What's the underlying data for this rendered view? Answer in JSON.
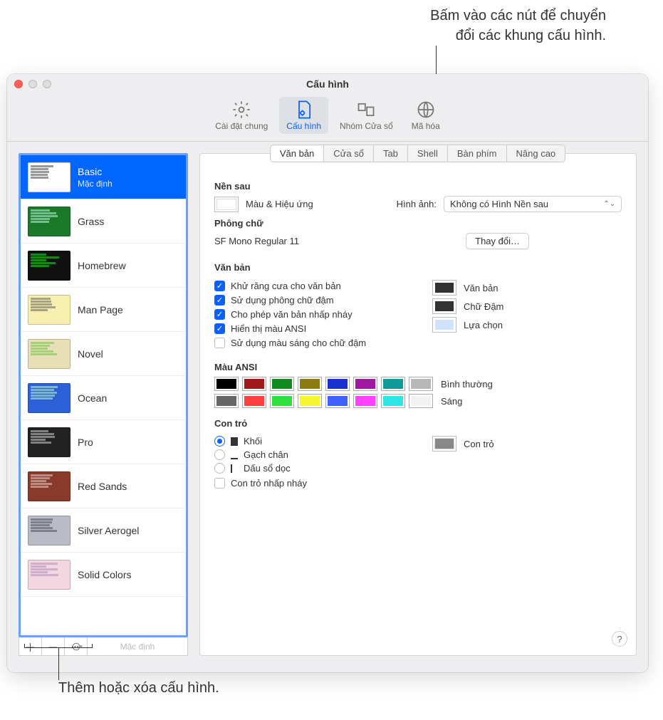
{
  "callouts": {
    "top": "Bấm vào các nút để chuyển\nđổi các khung cấu hình.",
    "bottom": "Thêm hoặc xóa cấu hình."
  },
  "window": {
    "title": "Cấu hình"
  },
  "toolbar": {
    "general": "Cài đặt chung",
    "profiles": "Cấu hình",
    "windowGroups": "Nhóm Cửa sổ",
    "encodings": "Mã hóa"
  },
  "profiles": [
    {
      "name": "Basic",
      "subtitle": "Mặc định",
      "bg": "#ffffff",
      "fg": "#333"
    },
    {
      "name": "Grass",
      "bg": "#1b7a2a",
      "fg": "#cfe"
    },
    {
      "name": "Homebrew",
      "bg": "#111",
      "fg": "#2f2"
    },
    {
      "name": "Man Page",
      "bg": "#f7efb0",
      "fg": "#555"
    },
    {
      "name": "Novel",
      "bg": "#e8dfb6",
      "fg": "#6b4"
    },
    {
      "name": "Ocean",
      "bg": "#2c5fd8",
      "fg": "#cfe"
    },
    {
      "name": "Pro",
      "bg": "#222",
      "fg": "#ddd"
    },
    {
      "name": "Red Sands",
      "bg": "#8a3a2a",
      "fg": "#edd"
    },
    {
      "name": "Silver Aerogel",
      "bg": "#b9bcc5",
      "fg": "#445"
    },
    {
      "name": "Solid Colors",
      "bg": "#f4d6e0",
      "fg": "#a8b"
    }
  ],
  "sidebarFooter": {
    "default": "Mặc định"
  },
  "panelTabs": [
    "Văn bản",
    "Cửa sổ",
    "Tab",
    "Shell",
    "Bàn phím",
    "Nâng cao"
  ],
  "sections": {
    "background": "Nền sau",
    "colorEffects": "Màu & Hiệu ứng",
    "imageLabel": "Hình ảnh:",
    "imageValue": "Không có Hình Nền sau",
    "font": "Phông chữ",
    "fontValue": "SF Mono Regular 11",
    "change": "Thay đổi…",
    "text": "Văn bản",
    "checks": {
      "antialias": "Khử răng cưa cho văn bản",
      "bold": "Sử dụng phông chữ đậm",
      "blink": "Cho phép văn bản nhấp nháy",
      "ansi": "Hiển thị màu ANSI",
      "bright": "Sử dụng màu sáng cho chữ đậm"
    },
    "wells": {
      "text": "Văn bản",
      "bold": "Chữ Đậm",
      "selection": "Lựa chọn"
    },
    "ansiTitle": "Màu ANSI",
    "ansiNormal": "Bình thường",
    "ansiBright": "Sáng",
    "ansiColors": {
      "normal": [
        "#000000",
        "#a01818",
        "#118a20",
        "#8a7a10",
        "#1a2fd0",
        "#a018a0",
        "#109a9a",
        "#b8b8b8"
      ],
      "bright": [
        "#666666",
        "#ff4040",
        "#30e040",
        "#f5f530",
        "#4060ff",
        "#ff40ff",
        "#30e5e5",
        "#f2f2f2"
      ]
    },
    "cursorTitle": "Con trỏ",
    "cursor": {
      "block": "Khối",
      "underline": "Gạch chân",
      "bar": "Dấu sổ dọc",
      "blink": "Con trỏ nhấp nháy",
      "well": "Con trỏ"
    }
  }
}
